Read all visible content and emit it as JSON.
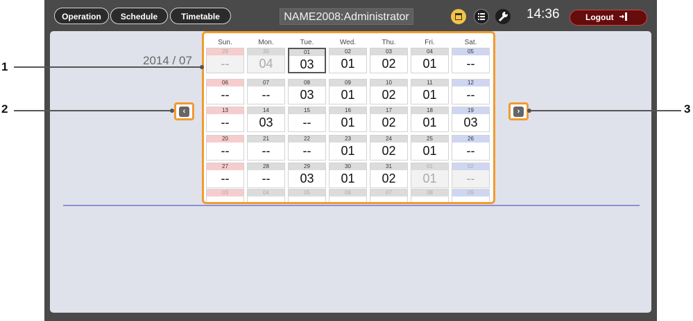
{
  "tabs": [
    "Operation",
    "Schedule",
    "Timetable"
  ],
  "header": {
    "title": "NAME2008:Administrator",
    "time": "14:36",
    "logout": "Logout"
  },
  "icons": {
    "calendar": "calendar-icon",
    "list": "list-icon",
    "settings": "wrench-icon",
    "logout": "exit-door-icon"
  },
  "colors": {
    "accent": "#f29a2e",
    "panel": "#dfe1eb",
    "logout_bg": "#650c0c"
  },
  "main": {
    "date_label": "2014 / 07"
  },
  "calendar": {
    "weekdays": [
      "Sun.",
      "Mon.",
      "Tue.",
      "Wed.",
      "Thu.",
      "Fri.",
      "Sat."
    ],
    "weeks": [
      [
        {
          "d": "29",
          "v": "--",
          "out": true
        },
        {
          "d": "30",
          "v": "04",
          "out": true
        },
        {
          "d": "01",
          "v": "03",
          "sel": true
        },
        {
          "d": "02",
          "v": "01"
        },
        {
          "d": "03",
          "v": "02"
        },
        {
          "d": "04",
          "v": "01"
        },
        {
          "d": "05",
          "v": "--"
        }
      ],
      [
        {
          "d": "06",
          "v": "--"
        },
        {
          "d": "07",
          "v": "--"
        },
        {
          "d": "08",
          "v": "03"
        },
        {
          "d": "09",
          "v": "01"
        },
        {
          "d": "10",
          "v": "02"
        },
        {
          "d": "11",
          "v": "01"
        },
        {
          "d": "12",
          "v": "--"
        }
      ],
      [
        {
          "d": "13",
          "v": "--"
        },
        {
          "d": "14",
          "v": "03"
        },
        {
          "d": "15",
          "v": "--"
        },
        {
          "d": "16",
          "v": "01"
        },
        {
          "d": "17",
          "v": "02"
        },
        {
          "d": "18",
          "v": "01"
        },
        {
          "d": "19",
          "v": "03"
        }
      ],
      [
        {
          "d": "20",
          "v": "--"
        },
        {
          "d": "21",
          "v": "--"
        },
        {
          "d": "22",
          "v": "--"
        },
        {
          "d": "23",
          "v": "01"
        },
        {
          "d": "24",
          "v": "02"
        },
        {
          "d": "25",
          "v": "01"
        },
        {
          "d": "26",
          "v": "--"
        }
      ],
      [
        {
          "d": "27",
          "v": "--"
        },
        {
          "d": "28",
          "v": "--"
        },
        {
          "d": "29",
          "v": "03"
        },
        {
          "d": "30",
          "v": "01"
        },
        {
          "d": "31",
          "v": "02"
        },
        {
          "d": "01",
          "v": "01",
          "out": true
        },
        {
          "d": "02",
          "v": "--",
          "out": true
        }
      ],
      [
        {
          "d": "03",
          "v": "",
          "out": true
        },
        {
          "d": "04",
          "v": "",
          "out": true
        },
        {
          "d": "05",
          "v": "",
          "out": true
        },
        {
          "d": "06",
          "v": "",
          "out": true
        },
        {
          "d": "07",
          "v": "",
          "out": true
        },
        {
          "d": "08",
          "v": "",
          "out": true
        },
        {
          "d": "09",
          "v": "",
          "out": true
        }
      ]
    ]
  },
  "nav": {
    "prev": "‹",
    "next": "›"
  },
  "callouts": [
    "1",
    "2",
    "3"
  ]
}
